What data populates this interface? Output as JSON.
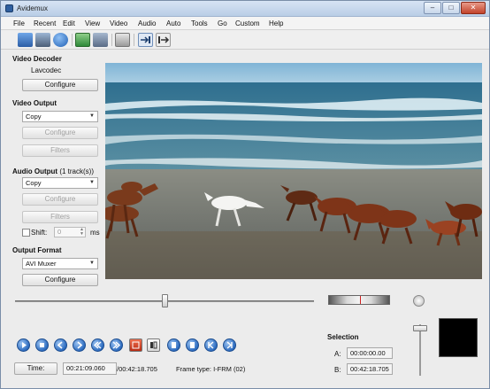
{
  "window": {
    "title": "Avidemux",
    "minimize_glyph": "–",
    "maximize_glyph": "□",
    "close_glyph": "✕"
  },
  "menu": [
    "File",
    "Recent",
    "Edit",
    "View",
    "Video",
    "Audio",
    "Auto",
    "Tools",
    "Go",
    "Custom",
    "Help"
  ],
  "toolbar": {
    "buttons": [
      "open-icon",
      "save-icon",
      "info-icon",
      "save-project-icon",
      "disk-icon",
      "calculator-icon",
      "toggle-input-icon",
      "toggle-output-icon"
    ]
  },
  "video_decoder": {
    "title": "Video Decoder",
    "codec": "Lavcodec",
    "configure_label": "Configure"
  },
  "video_output": {
    "title": "Video Output",
    "codec": "Copy",
    "configure_label": "Configure",
    "filters_label": "Filters"
  },
  "audio_output": {
    "title": "Audio Output",
    "tracks": "(1 track(s))",
    "codec": "Copy",
    "configure_label": "Configure",
    "filters_label": "Filters",
    "shift_label": "Shift:",
    "shift_value": "0",
    "shift_unit": "ms"
  },
  "output_format": {
    "title": "Output Format",
    "muxer": "AVI Muxer",
    "configure_label": "Configure"
  },
  "navigation": {
    "buttons": [
      "play-icon",
      "stop-icon",
      "previous-frame-icon",
      "next-frame-icon",
      "previous-keyframe-icon",
      "next-keyframe-icon",
      "marker-a-icon",
      "marker-b-icon",
      "previous-black-frame-icon",
      "next-black-frame-icon",
      "first-frame-icon",
      "last-frame-icon"
    ]
  },
  "selection": {
    "title": "Selection",
    "a_label": "A:",
    "a_value": "00:00:00.00",
    "b_label": "B:",
    "b_value": "00:42:18.705"
  },
  "status": {
    "time_label": "Time:",
    "current_time": "00:21:09.060",
    "total_time": "/00:42:18.705",
    "frame_type": "Frame type:  I-FRM (02)"
  },
  "timeline": {
    "position_fraction": 0.5
  },
  "colors": {
    "accent": "#2d6cc0",
    "titlebar": "#c9d9ee",
    "panel": "#ececec"
  }
}
